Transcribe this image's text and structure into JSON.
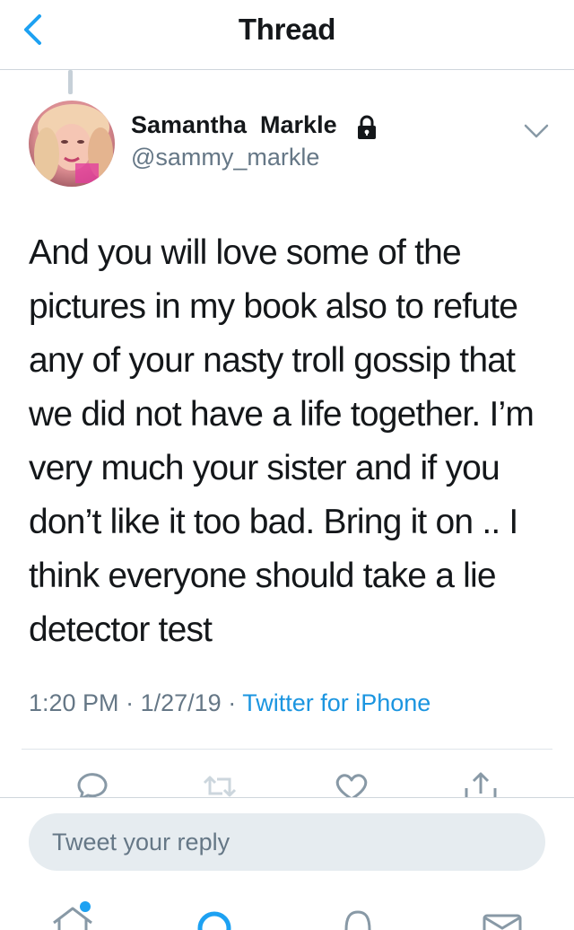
{
  "header": {
    "title": "Thread",
    "back_icon": "chevron-left-icon"
  },
  "tweet": {
    "author_name": "Samantha  Markle",
    "author_handle": "@sammy_markle",
    "protected_icon": "lock-icon",
    "text": "And you will love some of the pictures in my book also to refute any of your nasty troll gossip that we did not have a life together. I’m very much your sister and if you don’t like it too bad. Bring it on .. I think everyone should take a lie detector test",
    "time": "1:20 PM",
    "separator": "·",
    "date": "1/27/19",
    "source": "Twitter for iPhone"
  },
  "actions": {
    "reply_icon": "comment-icon",
    "retweet_icon": "retweet-icon",
    "like_icon": "heart-icon",
    "share_icon": "share-icon"
  },
  "reply": {
    "placeholder": "Tweet your reply"
  },
  "tabbar": {
    "home_icon": "home-icon",
    "search_icon": "search-icon",
    "notifications_icon": "bell-icon",
    "messages_icon": "mail-icon"
  },
  "colors": {
    "accent": "#1da1f2",
    "link": "#1b95e0",
    "secondary_text": "#657786",
    "divider": "#cfd6dc"
  }
}
